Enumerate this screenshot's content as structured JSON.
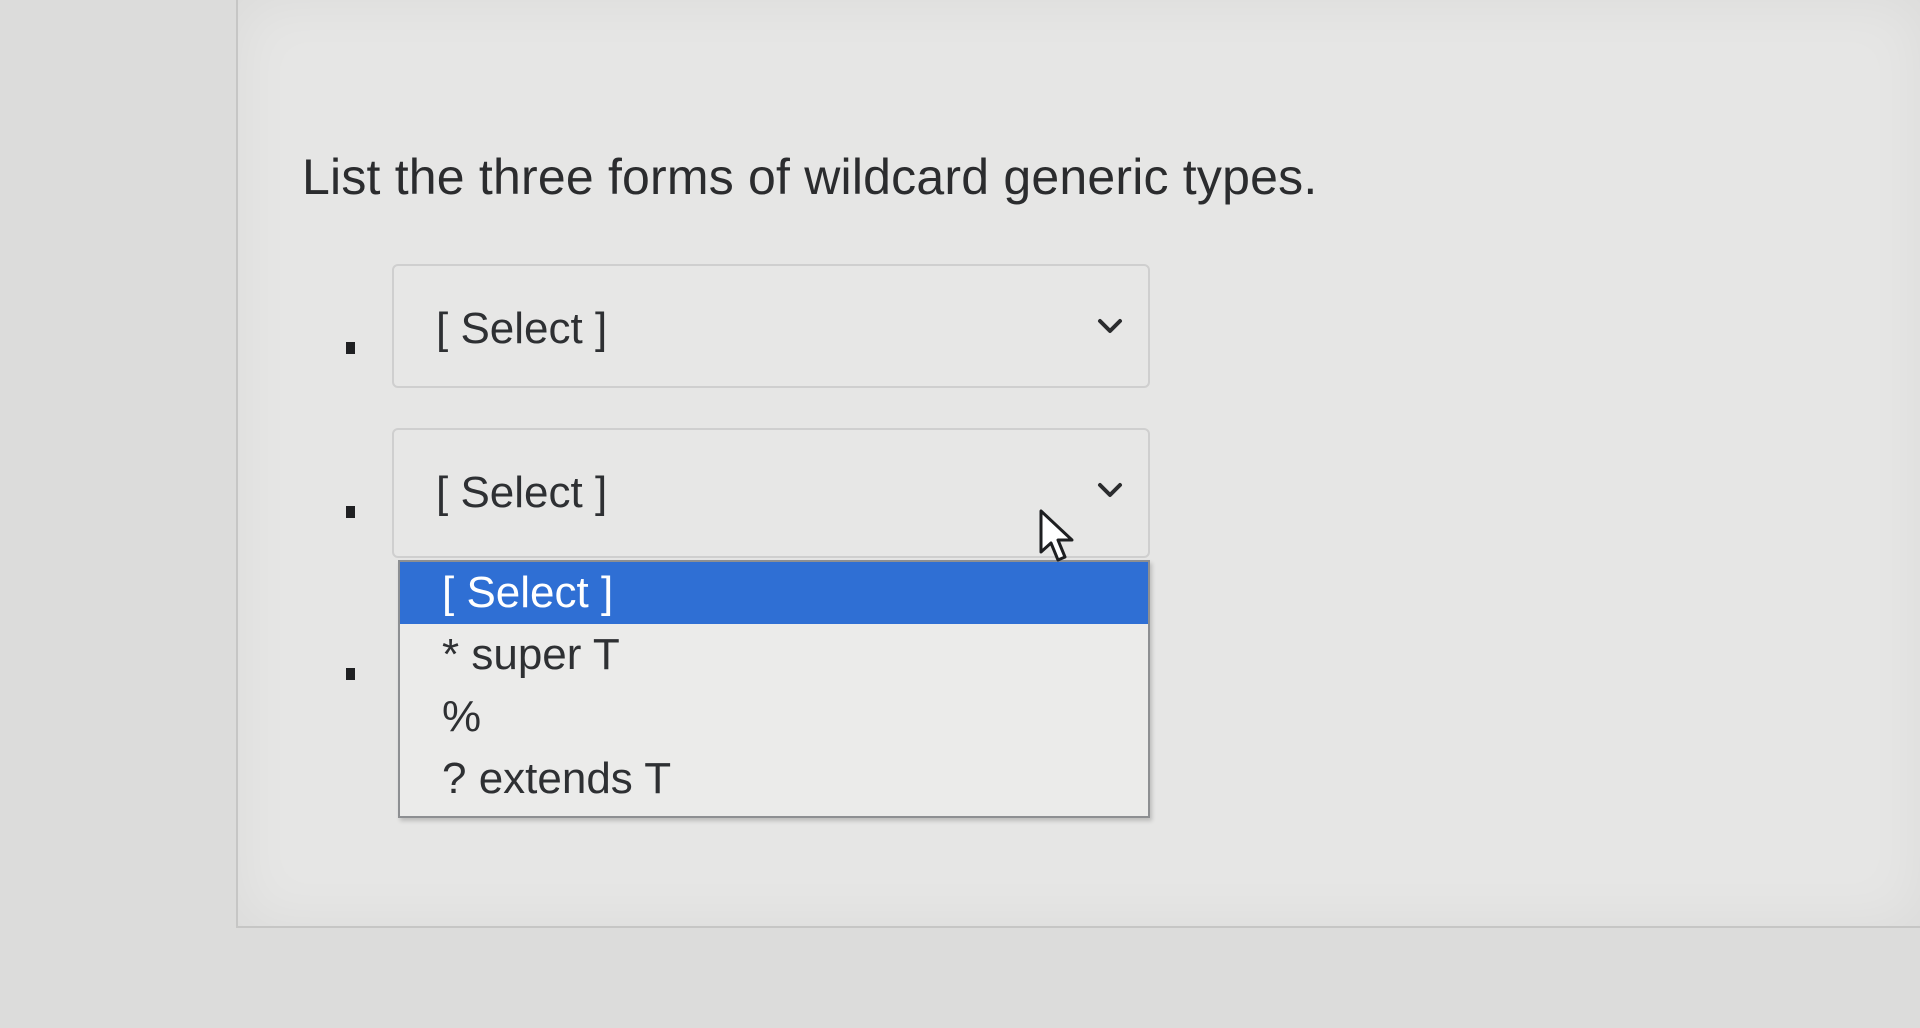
{
  "question": {
    "text": "List the three forms of wildcard generic types."
  },
  "selects": [
    {
      "value": "[ Select ]"
    },
    {
      "value": "[ Select ]"
    }
  ],
  "dropdown": {
    "options": [
      {
        "label": "[ Select ]",
        "selected": true
      },
      {
        "label": "* super T",
        "selected": false
      },
      {
        "label": "%",
        "selected": false
      },
      {
        "label": "? extends T",
        "selected": false
      }
    ]
  },
  "icons": {
    "chevron": "chevron-down-icon",
    "cursor": "mouse-pointer-icon"
  },
  "colors": {
    "highlight": "#2f6fd4",
    "highlight_text": "#ffffff"
  }
}
